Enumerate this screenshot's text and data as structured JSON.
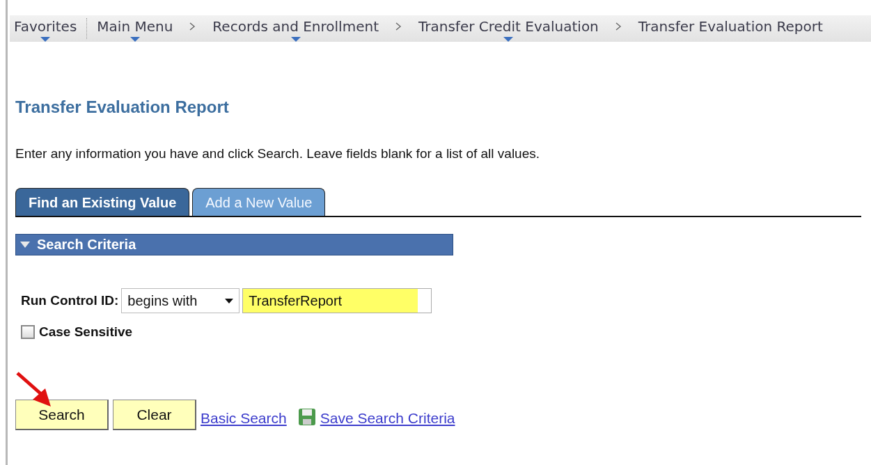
{
  "breadcrumbs": [
    {
      "label": "Favorites",
      "dropdown": true,
      "dotted_divider_after": true,
      "chevron_after": false
    },
    {
      "label": "Main Menu",
      "dropdown": true,
      "dotted_divider_after": false,
      "chevron_after": true
    },
    {
      "label": "Records and Enrollment",
      "dropdown": true,
      "dotted_divider_after": false,
      "chevron_after": true
    },
    {
      "label": "Transfer Credit Evaluation",
      "dropdown": true,
      "dotted_divider_after": false,
      "chevron_after": true
    },
    {
      "label": "Transfer Evaluation Report",
      "dropdown": false,
      "dotted_divider_after": false,
      "chevron_after": false
    }
  ],
  "page_title": "Transfer Evaluation Report",
  "instructions": "Enter any information you have and click Search. Leave fields blank for a list of all values.",
  "tabs": [
    {
      "label": "Find an Existing Value",
      "selected": true
    },
    {
      "label": "Add a New Value",
      "selected": false
    }
  ],
  "section": {
    "title": "Search Criteria",
    "expanded": true
  },
  "run_control": {
    "label": "Run Control ID:",
    "operator": "begins with",
    "value": "TransferReport"
  },
  "case_sensitive": {
    "label": "Case Sensitive",
    "checked": false
  },
  "buttons": [
    "Search",
    "Clear"
  ],
  "links": [
    "Basic Search",
    "Save Search Criteria"
  ]
}
